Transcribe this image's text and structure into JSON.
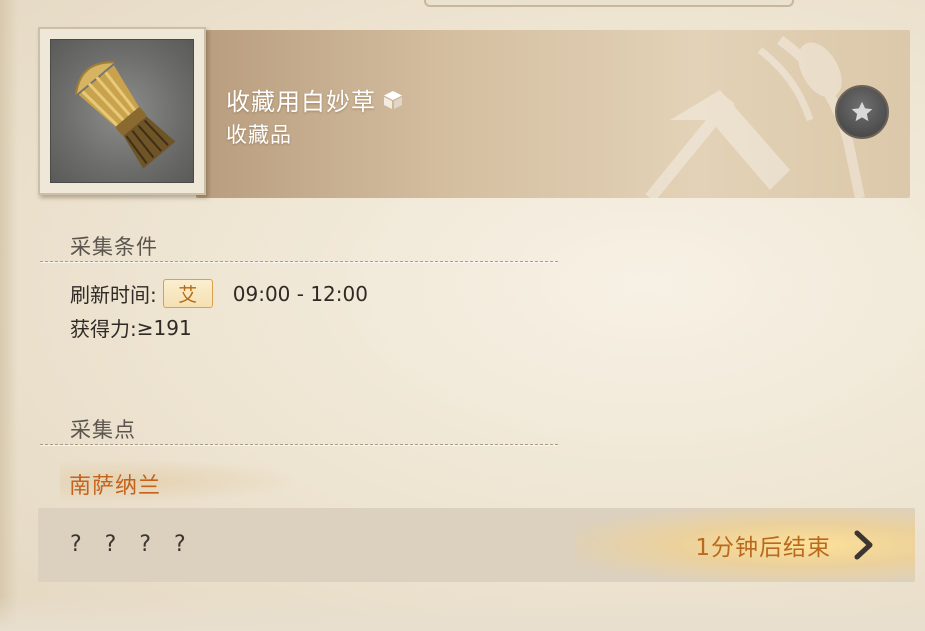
{
  "item": {
    "name": "收藏用白妙草",
    "category": "收藏品",
    "icon": "wheat-bundle-icon",
    "collectable_icon": "cube-icon"
  },
  "conditions": {
    "title": "采集条件",
    "refresh_label": "刷新时间:",
    "era_badge": "艾",
    "time_range": "09:00 - 12:00",
    "gathering_label": "获得力:",
    "gathering_value": "≥191"
  },
  "points": {
    "title": "采集点",
    "location": "南萨纳兰",
    "node_name": "? ? ? ?",
    "timer": "1分钟后结束",
    "arrow_icon": "chevron-right-icon"
  },
  "colors": {
    "accent_orange": "#c4631c",
    "badge_border": "#d9a14e",
    "timer_text": "#b96a1e"
  }
}
